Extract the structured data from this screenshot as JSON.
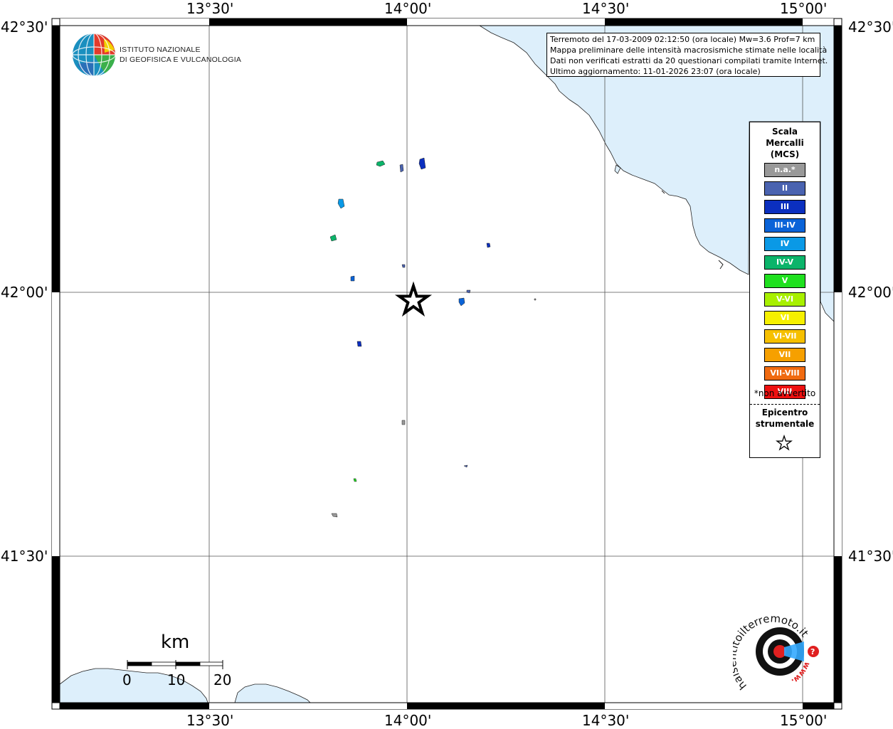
{
  "map": {
    "top_lon_labels": [
      "13°30'",
      "14°00'",
      "14°30'",
      "15°00'"
    ],
    "bottom_lon_labels": [
      "13°30'",
      "14°00'",
      "14°30'",
      "15°00'"
    ],
    "left_lat_labels": [
      "42°30'",
      "42°00'",
      "41°30'"
    ],
    "right_lat_labels": [
      "42°30'",
      "42°00'",
      "41°30'"
    ],
    "sea_color": "#ddeffb",
    "grid_color": "#555555"
  },
  "info": {
    "line1": "Terremoto del 17-03-2009 02:12:50 (ora locale) Mw=3.6 Prof=7 km",
    "line2": "Mappa preliminare delle intensità macrosismiche stimate nelle località",
    "line3": "Dati non verificati estratti da 20 questionari compilati tramite Internet.",
    "line4": "Ultimo aggiornamento: 11-01-2026 23:07 (ora locale)"
  },
  "ingv": {
    "line1": "ISTITUTO NAZIONALE",
    "line2": "DI GEOFISICA E VULCANOLOGIA"
  },
  "legend": {
    "title1": "Scala",
    "title2": "Mercalli",
    "title3": "(MCS)",
    "items": [
      {
        "label": "n.a.*",
        "color": "#999999"
      },
      {
        "label": "II",
        "color": "#4a63b0"
      },
      {
        "label": "III",
        "color": "#0b2fbf"
      },
      {
        "label": "III-IV",
        "color": "#0a63d8"
      },
      {
        "label": "IV",
        "color": "#0a99e6"
      },
      {
        "label": "IV-V",
        "color": "#0bb46a"
      },
      {
        "label": "V",
        "color": "#1fe01f"
      },
      {
        "label": "V-VI",
        "color": "#a8f000"
      },
      {
        "label": "VI",
        "color": "#f6f000"
      },
      {
        "label": "VI-VII",
        "color": "#f6c000"
      },
      {
        "label": "VII",
        "color": "#f6a000"
      },
      {
        "label": "VII-VIII",
        "color": "#f06a10"
      },
      {
        "label": "VIII",
        "color": "#ee1010"
      }
    ],
    "note": "*non avvertito",
    "epi1": "Epicentro",
    "epi2": "strumentale"
  },
  "scalebar": {
    "title": "km",
    "labels": [
      "0",
      "10",
      "20"
    ]
  },
  "logo": {
    "text": "haisentitoilterremoto.it",
    "prefix": "www."
  }
}
